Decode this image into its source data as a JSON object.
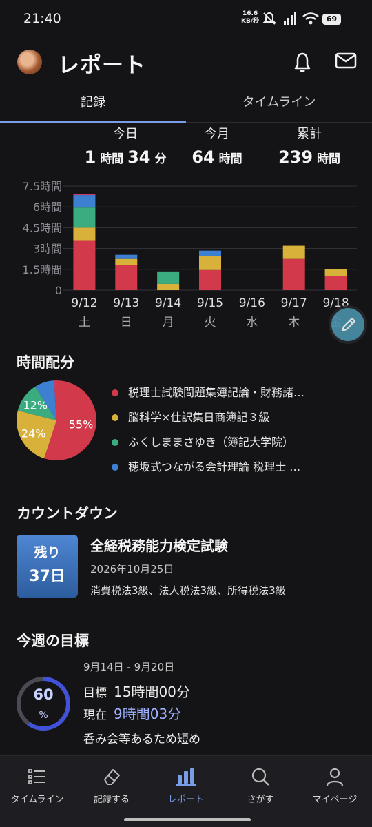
{
  "status_bar": {
    "time": "21:40",
    "net_speed_value": "16.6",
    "net_speed_unit": "KB/秒",
    "battery": "69",
    "icons": [
      "mute-icon",
      "signal-icon",
      "wifi-icon",
      "battery-icon"
    ]
  },
  "header": {
    "title": "レポート",
    "icons": [
      "bell-icon",
      "mail-icon"
    ]
  },
  "tabs": [
    {
      "label": "記録",
      "active": true
    },
    {
      "label": "タイムライン",
      "active": false
    }
  ],
  "totals": [
    {
      "label": "今日",
      "parts": [
        "1",
        "時間",
        "34",
        "分"
      ]
    },
    {
      "label": "今月",
      "parts": [
        "64",
        "時間"
      ]
    },
    {
      "label": "累計",
      "parts": [
        "239",
        "時間"
      ]
    }
  ],
  "chart_data": {
    "type": "bar",
    "stacked": true,
    "categories": [
      "9/12",
      "9/13",
      "9/14",
      "9/15",
      "9/16",
      "9/17",
      "9/18"
    ],
    "weekdays": [
      "土",
      "日",
      "月",
      "火",
      "水",
      "木",
      "金"
    ],
    "y_tick_labels": [
      "0",
      "1.5時間",
      "3時間",
      "4.5時間",
      "6時間",
      "7.5時間"
    ],
    "y_ticks": [
      0,
      1.5,
      3,
      4.5,
      6,
      7.5
    ],
    "ylim": [
      0,
      7.5
    ],
    "grid": true,
    "series": [
      {
        "color": "#d2394b",
        "values": [
          3.6,
          1.8,
          0,
          1.45,
          0,
          2.25,
          1.0
        ]
      },
      {
        "color": "#d8b13a",
        "values": [
          0.9,
          0.45,
          0.45,
          1.0,
          0,
          0.95,
          0.5
        ]
      },
      {
        "color": "#3bab80",
        "values": [
          1.45,
          0,
          0.9,
          0,
          0,
          0,
          0
        ]
      },
      {
        "color": "#3d80d2",
        "values": [
          0.9,
          0.3,
          0,
          0.4,
          0,
          0,
          0
        ]
      },
      {
        "color": "#c0406a",
        "values": [
          0.1,
          0,
          0,
          0,
          0,
          0,
          0
        ]
      }
    ]
  },
  "time_allocation": {
    "title": "時間配分",
    "pie": [
      {
        "label": "55%",
        "value": 55,
        "color": "#d2394b"
      },
      {
        "label": "24%",
        "value": 24,
        "color": "#d8b13a"
      },
      {
        "label": "12%",
        "value": 12,
        "color": "#3bab80"
      },
      {
        "label": "",
        "value": 8,
        "color": "#3d80d2"
      },
      {
        "label": "",
        "value": 1,
        "color": "#c0406a"
      }
    ],
    "legend": [
      {
        "label": "税理士試験問題集簿記論・財務諸…",
        "color": "#d2394b"
      },
      {
        "label": "脳科学×仕訳集日商簿記３級",
        "color": "#d8b13a"
      },
      {
        "label": "ふくしままさゆき（簿記大学院）",
        "color": "#3bab80"
      },
      {
        "label": "穂坂式つながる会計理論 税理士 …",
        "color": "#3d80d2"
      }
    ]
  },
  "countdown": {
    "title": "カウントダウン",
    "badge_line1": "残り",
    "badge_line2": "37日",
    "exam_name": "全経税務能力検定試験",
    "date": "2026年10月25日",
    "subjects": "消費税法3級、法人税法3級、所得税法3級"
  },
  "weekly_goal": {
    "title": "今週の目標",
    "range": "9月14日 - 9月20日",
    "percent": 60,
    "percent_text": "60",
    "percent_unit": "%",
    "target_label": "目標",
    "target_value": "15時間00分",
    "current_label": "現在",
    "current_value": "9時間03分",
    "note": "呑み会等あるため短め",
    "accent": "#3f52d9"
  },
  "bottom_nav": [
    {
      "label": "タイムライン",
      "icon": "list-icon",
      "active": false
    },
    {
      "label": "記録する",
      "icon": "eraser-icon",
      "active": false
    },
    {
      "label": "レポート",
      "icon": "bar-chart-icon",
      "active": true
    },
    {
      "label": "さがす",
      "icon": "search-icon",
      "active": false
    },
    {
      "label": "マイページ",
      "icon": "person-icon",
      "active": false
    }
  ]
}
